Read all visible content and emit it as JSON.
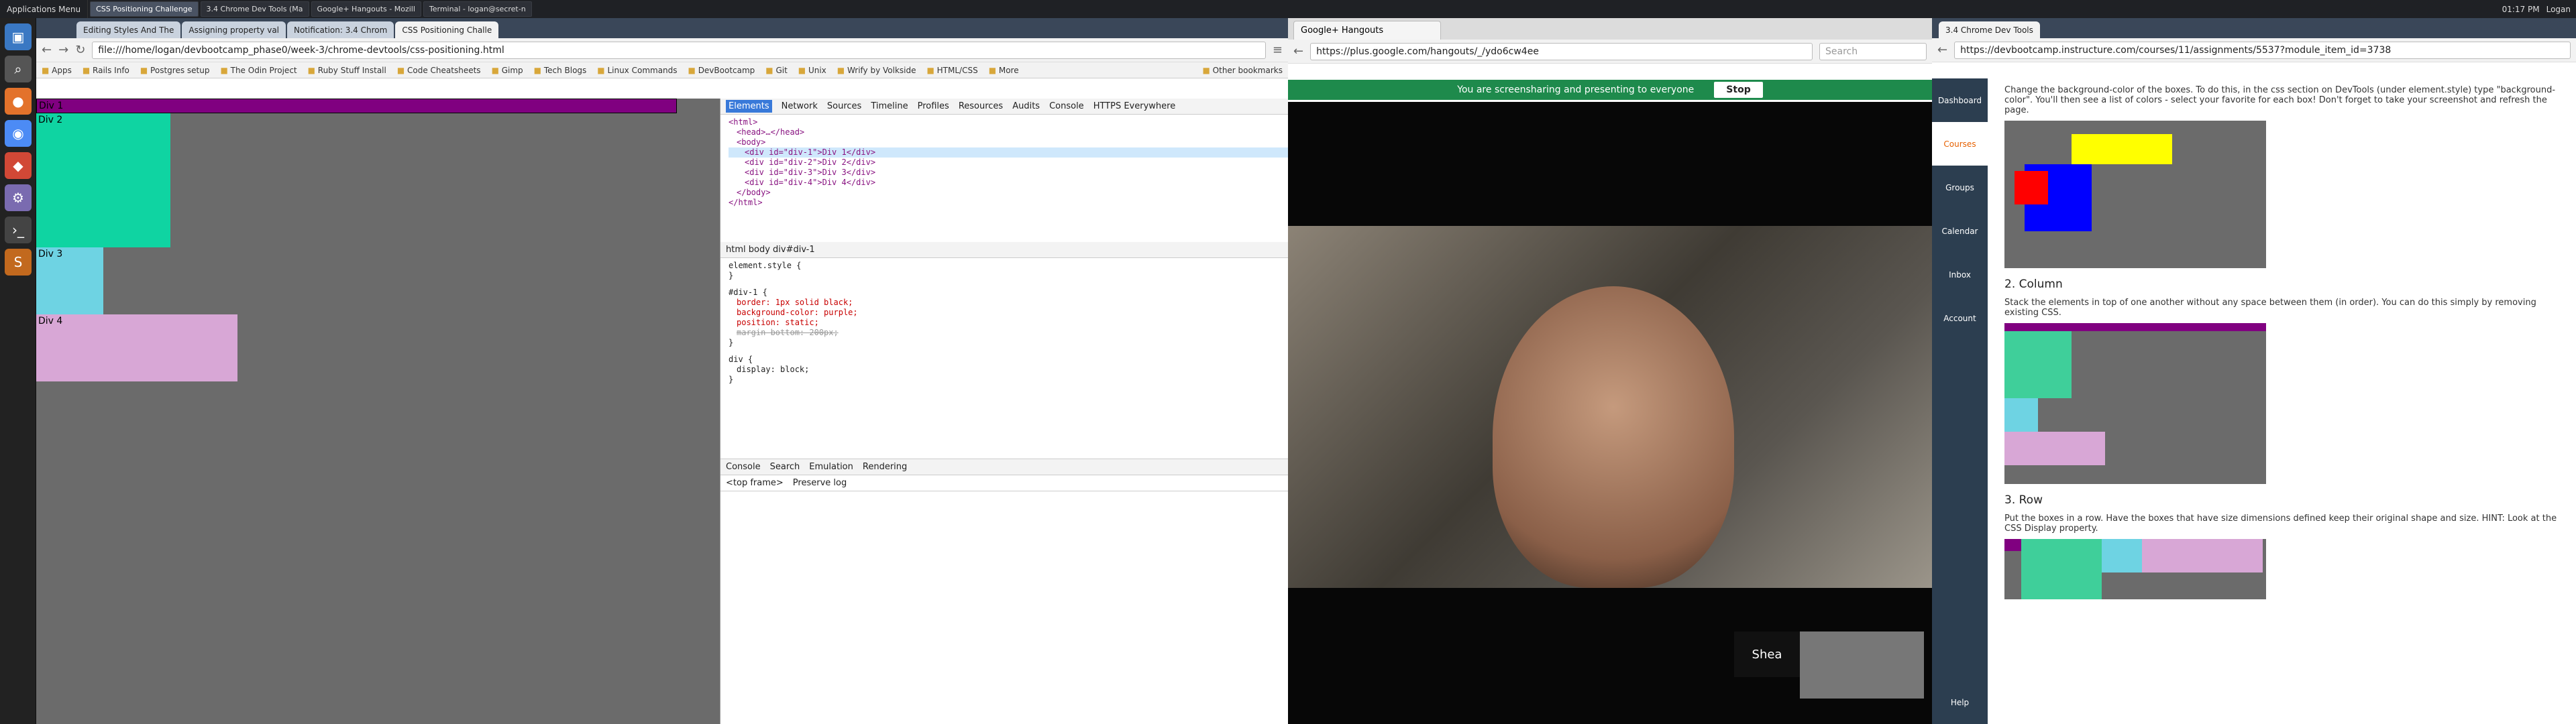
{
  "topbar": {
    "apps": "Applications Menu",
    "tasks": [
      "CSS Positioning Challenge",
      "3.4 Chrome Dev Tools (Ma",
      "Google+ Hangouts - Mozill",
      "Terminal - logan@secret-n"
    ],
    "time": "01:17 PM",
    "user": "Logan"
  },
  "chrome": {
    "tabs": [
      "Editing Styles And The",
      "Assigning property val",
      "Notification: 3.4 Chrom",
      "CSS Positioning Challe"
    ],
    "url": "file:///home/logan/devbootcamp_phase0/week-3/chrome-devtools/css-positioning.html",
    "bookmarks": [
      "Apps",
      "Rails Info",
      "Postgres setup",
      "The Odin Project",
      "Ruby Stuff Install",
      "Code Cheatsheets",
      "Gimp",
      "Tech Blogs",
      "Linux Commands",
      "DevBootcamp",
      "Git",
      "Unix",
      "Wrify by Volkside",
      "HTML/CSS",
      "More"
    ],
    "other": "Other bookmarks"
  },
  "page": {
    "divs": [
      "Div 1",
      "Div 2",
      "Div 3",
      "Div 4"
    ]
  },
  "devtools": {
    "tabs": [
      "Elements",
      "Network",
      "Sources",
      "Timeline",
      "Profiles",
      "Resources",
      "Audits",
      "Console",
      "HTTPS Everywhere"
    ],
    "html": [
      "<html>",
      "<head>…</head>",
      "<body>",
      "<div id=\"div-1\">Div 1</div>",
      "<div id=\"div-2\">Div 2</div>",
      "<div id=\"div-3\">Div 3</div>",
      "<div id=\"div-4\">Div 4</div>",
      "</body>",
      "</html>"
    ],
    "crumbs": "html   body   div#div-1",
    "styles": [
      "element.style {",
      "}",
      "#div-1 {",
      "border: 1px solid black;",
      "background-color: purple;",
      "position: static;",
      "margin-bottom: 200px;",
      "}",
      "div {",
      "display: block;",
      "}"
    ],
    "console": [
      "Console",
      "Search",
      "Emulation",
      "Rendering"
    ],
    "frame": "<top frame>",
    "preserve": "Preserve log"
  },
  "firefox": {
    "title": "Google+ Hangouts - Mozilla Firefox",
    "tab": "Google+ Hangouts",
    "url": "https://plus.google.com/hangouts/_/ydo6cw4ee",
    "search": "Search",
    "banner": "You are screensharing and presenting to everyone",
    "stop": "Stop",
    "name": "Shea"
  },
  "canvas": {
    "tab": "3.4 Chrome Dev Tools",
    "url": "https://devbootcamp.instructure.com/courses/11/assignments/5537?module_item_id=3738",
    "nav": [
      "Dashboard",
      "Courses",
      "Groups",
      "Calendar",
      "Inbox",
      "Account",
      "Help"
    ],
    "p1": "Change the background-color of the boxes. To do this, in the css section on DevTools (under element.style) type \"background-color\". You'll then see a list of colors - select your favorite for each box! Don't forget to take your screenshot and refresh the page.",
    "h2": "2. Column",
    "p2": "Stack the elements in top of one another without any space between them (in order). You can do this simply by removing existing CSS.",
    "h3": "3. Row",
    "p3": "Put the boxes in a row. Have the boxes that have size dimensions defined keep their original shape and size. HINT: Look at the CSS Display property."
  }
}
